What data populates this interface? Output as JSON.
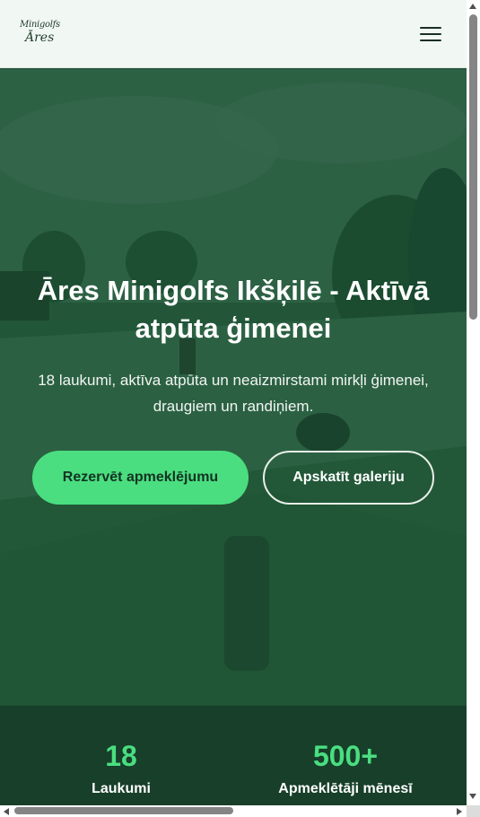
{
  "header": {
    "logo_line1": "Minigolfs",
    "logo_line2": "Āres",
    "menu_icon": "hamburger-menu-icon"
  },
  "hero": {
    "title": "Āres Minigolfs Ikšķilē - Aktīvā atpūta ģimenei",
    "subtitle": "18 laukumi, aktīva atpūta un neaizmirstami mirkļi ģimenei, draugiem un randiņiem.",
    "primary_button": "Rezervēt apmeklējumu",
    "secondary_button": "Apskatīt galeriju"
  },
  "stats": [
    {
      "value": "18",
      "label": "Laukumi"
    },
    {
      "value": "500+",
      "label": "Apmeklētāji mēnesī"
    }
  ],
  "colors": {
    "accent": "#4ade80",
    "header_bg": "#f1f8f3",
    "hero_overlay": "#2b5a40",
    "stats_bg": "#173f2a"
  }
}
